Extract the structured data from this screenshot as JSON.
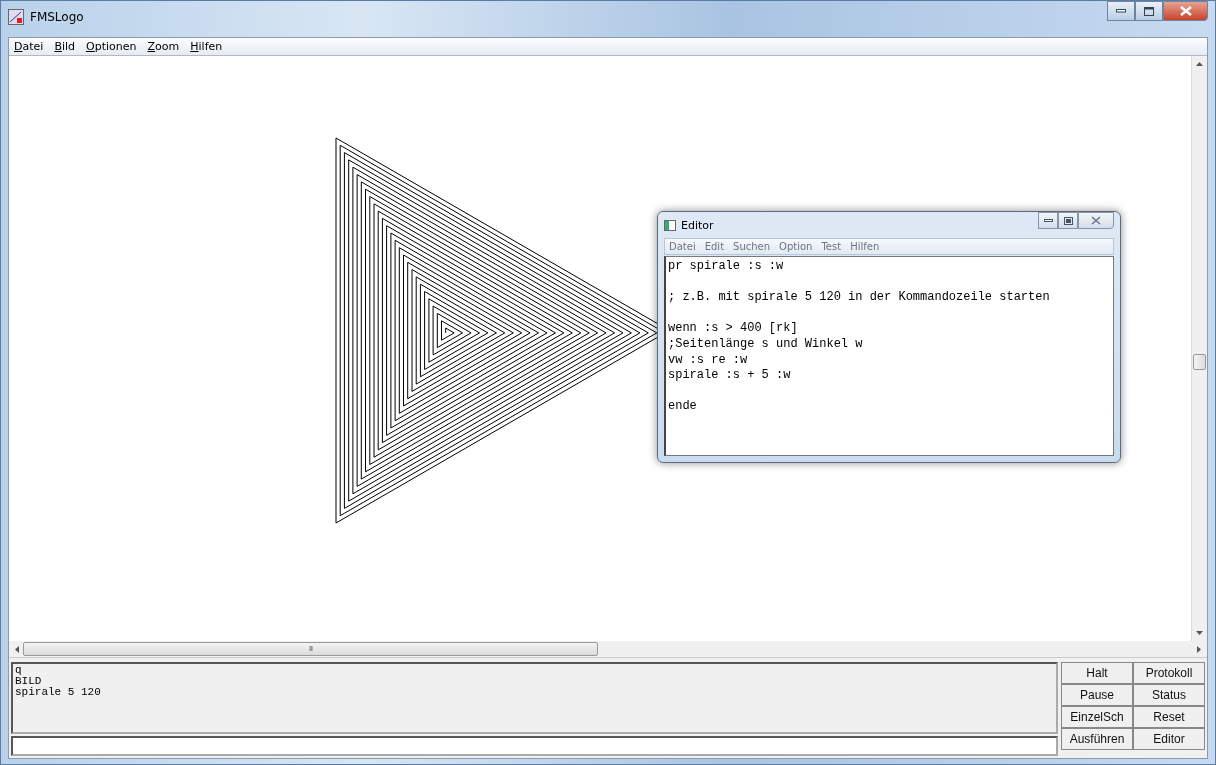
{
  "window": {
    "title": "FMSLogo"
  },
  "menu": [
    "Datei",
    "Bild",
    "Optionen",
    "Zoom",
    "Hilfen"
  ],
  "editor": {
    "title": "Editor",
    "menu": [
      "Datei",
      "Edit",
      "Suchen",
      "Option",
      "Test",
      "Hilfen"
    ],
    "text": "pr spirale :s :w\n\n; z.B. mit spirale 5 120 in der Kommandozeile starten\n\nwenn :s > 400 [rk]\n;Seitenlänge s und Winkel w\nvw :s re :w\nspirale :s + 5 :w\n\nende"
  },
  "scrollbar": {
    "h_thumb": "III"
  },
  "commander": {
    "history": "q\nBILD\nspirale 5 120",
    "buttons": [
      "Halt",
      "Protokoll",
      "Pause",
      "Status",
      "EinzelSch",
      "Reset",
      "Ausführen",
      "Editor"
    ]
  }
}
